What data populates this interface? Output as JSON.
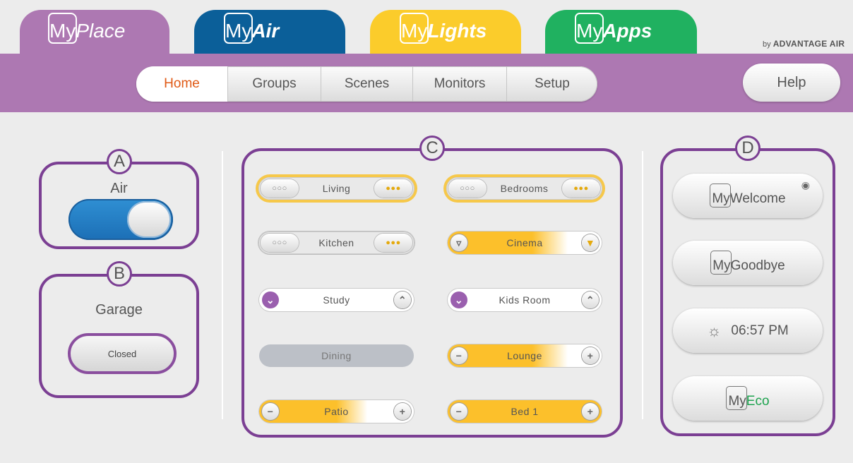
{
  "tabs": [
    {
      "name": "tab-myplace",
      "my": "My",
      "suffix": "Place",
      "color": "#ad78b2"
    },
    {
      "name": "tab-myair",
      "my": "My",
      "suffix": "Air",
      "color": "#0b5f99"
    },
    {
      "name": "tab-mylights",
      "my": "My",
      "suffix": "Lights",
      "color": "#fbcc2b"
    },
    {
      "name": "tab-myapps",
      "my": "My",
      "suffix": "Apps",
      "color": "#20b160"
    }
  ],
  "brand": {
    "by": "by ",
    "name": "ADVANTAGE AIR"
  },
  "nav": {
    "items": [
      "Home",
      "Groups",
      "Scenes",
      "Monitors",
      "Setup"
    ],
    "active": "Home",
    "active_color": "#e05a16",
    "help": "Help"
  },
  "panels": {
    "a": {
      "label": "A",
      "title": "Air",
      "toggle_state": "on"
    },
    "b": {
      "label": "B",
      "title": "Garage",
      "button": "Closed"
    },
    "c": {
      "label": "C"
    },
    "d": {
      "label": "D"
    }
  },
  "lights": {
    "living": "Living",
    "bedrooms": "Bedrooms",
    "kitchen": "Kitchen",
    "cinema": "Cinema",
    "study": "Study",
    "kids_room": "Kids Room",
    "dining": "Dining",
    "lounge": "Lounge",
    "patio": "Patio",
    "bed1": "Bed 1"
  },
  "scenes": {
    "welcome": {
      "my": "My",
      "suffix": "Welcome"
    },
    "goodbye": {
      "my": "My",
      "suffix": "Goodbye"
    },
    "timer": {
      "time": "06:57 PM",
      "icon": "sunset-icon"
    },
    "eco": {
      "my": "My",
      "suffix": "Eco",
      "suffix_color": "#1ea34f"
    }
  },
  "colors": {
    "panel_border": "#7b3f93",
    "navbar": "#ad78b2",
    "light_on": "#fcc02b"
  }
}
